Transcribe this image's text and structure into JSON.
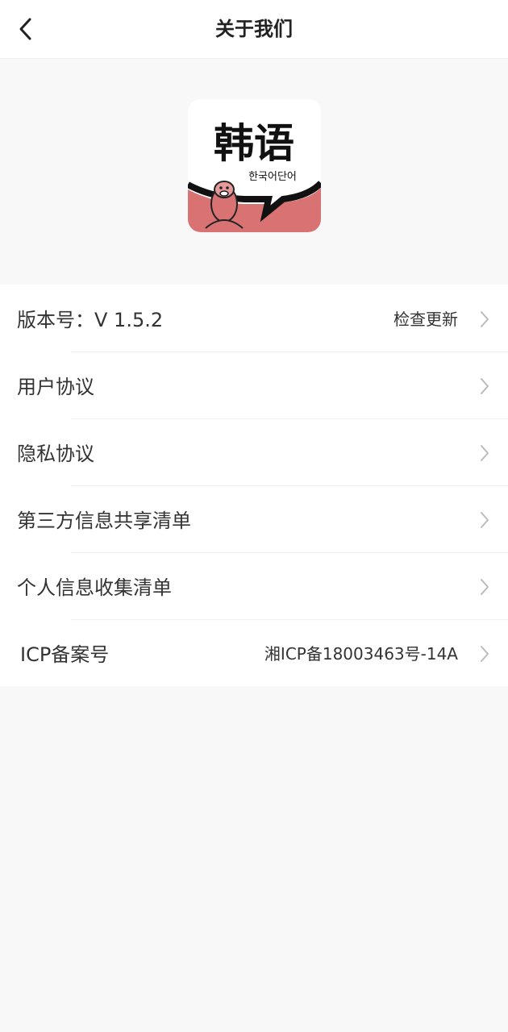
{
  "header": {
    "title": "关于我们"
  },
  "logo": {
    "title_text": "韩语",
    "korean_text": "한국어단어",
    "accent_color": "#d97373"
  },
  "list": {
    "items": [
      {
        "label": "版本号：V 1.5.2",
        "value": "检查更新"
      },
      {
        "label": "用户协议",
        "value": ""
      },
      {
        "label": "隐私协议",
        "value": ""
      },
      {
        "label": "第三方信息共享清单",
        "value": ""
      },
      {
        "label": "个人信息收集清单",
        "value": ""
      },
      {
        "label": "ICP备案号",
        "value": "湘ICP备18003463号-14A"
      }
    ]
  },
  "icons": {
    "back": "chevron-left-icon",
    "row_arrow": "chevron-right-icon"
  }
}
